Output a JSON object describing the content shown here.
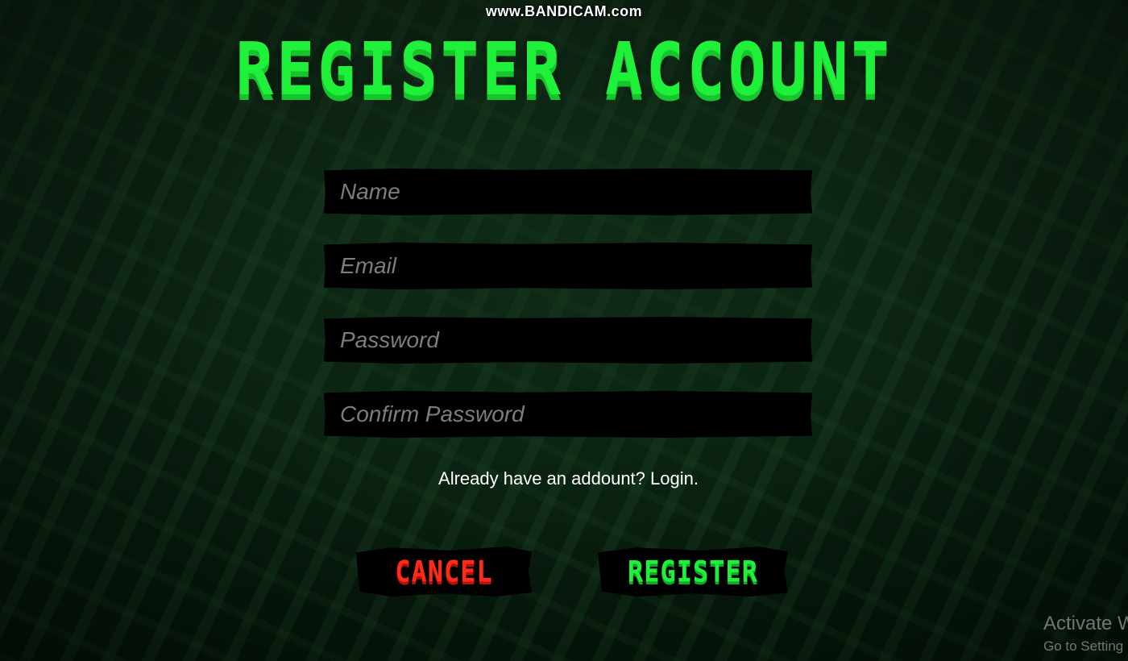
{
  "watermark": "www.BANDICAM.com",
  "page_title": "REGISTER ACCOUNT",
  "form": {
    "fields": [
      {
        "placeholder": "Name",
        "value": ""
      },
      {
        "placeholder": "Email",
        "value": ""
      },
      {
        "placeholder": "Password",
        "value": ""
      },
      {
        "placeholder": "Confirm Password",
        "value": ""
      }
    ]
  },
  "login_prompt": "Already have an addount? Login.",
  "buttons": {
    "cancel_label": "CANCEL",
    "register_label": "REGISTER"
  },
  "windows_notice": {
    "title": "Activate W",
    "subtitle": "Go to Setting"
  },
  "colors": {
    "title_green": "#1ff03a",
    "cancel_red": "#ff2a1a",
    "field_bg": "#000000",
    "placeholder_gray": "#7d7d7d"
  }
}
